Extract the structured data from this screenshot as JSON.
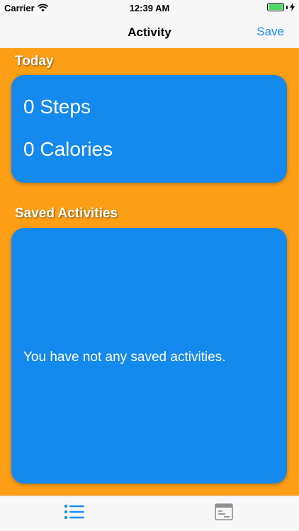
{
  "status_bar": {
    "carrier": "Carrier",
    "time": "12:39 AM"
  },
  "nav": {
    "title": "Activity",
    "save_label": "Save"
  },
  "today": {
    "title": "Today",
    "steps": "0 Steps",
    "calories": "0 Calories"
  },
  "saved": {
    "title": "Saved Activities",
    "empty_message": "You have not any saved activities."
  },
  "tabs": [
    {
      "icon": "list-icon",
      "selected": true
    },
    {
      "icon": "calendar-icon",
      "selected": false
    }
  ],
  "colors": {
    "accent": "#1a8cff",
    "background": "#ff9f16",
    "card": "#1489ee"
  }
}
